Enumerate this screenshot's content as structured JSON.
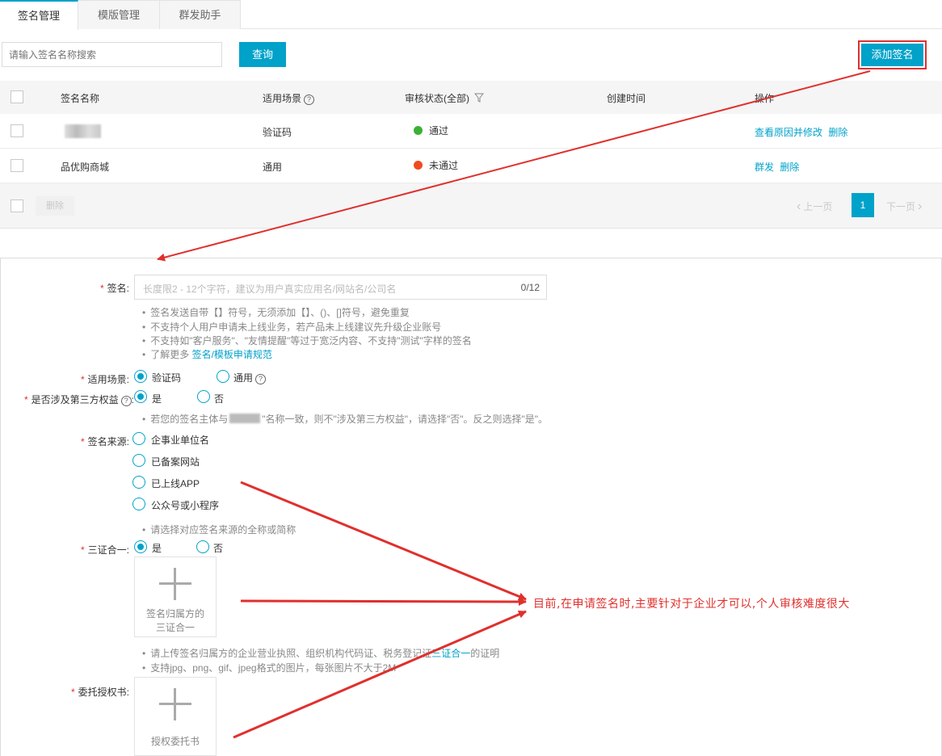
{
  "tabs": [
    "签名管理",
    "模版管理",
    "群发助手"
  ],
  "search": {
    "placeholder": "请输入签名名称搜索",
    "query_label": "查询"
  },
  "add_button": "添加签名",
  "table": {
    "columns": [
      "签名名称",
      "适用场景",
      "审核状态(全部)",
      "创建时间",
      "操作"
    ],
    "rows": [
      {
        "name": "",
        "scene": "验证码",
        "status": "通过",
        "status_color": "#3cb034",
        "actions": [
          "查看原因并修改",
          "删除"
        ]
      },
      {
        "name": "品优购商城",
        "scene": "通用",
        "status": "未通过",
        "status_color": "#f04a22",
        "actions": [
          "群发",
          "删除"
        ]
      }
    ],
    "footer": {
      "delete_label": "删除",
      "prev": "上一页",
      "page": "1",
      "next": "下一页"
    }
  },
  "form": {
    "sign_label": "签名:",
    "sign_placeholder": "长度限2 - 12个字符，建议为用户真实应用名/网站名/公司名",
    "sign_count": "0/12",
    "sign_hints": [
      "签名发送自带【】符号，无须添加【】、()、[]符号，避免重复",
      "不支持个人用户申请未上线业务，若产品未上线建议先升级企业账号",
      "不支持如\"客户服务\"、\"友情提醒\"等过于宽泛内容、不支持\"测试\"字样的签名"
    ],
    "sign_hint_more_prefix": "了解更多",
    "sign_hint_more_link": "签名/模板申请规范",
    "scene_label": "适用场景:",
    "scene_options": [
      "验证码",
      "通用"
    ],
    "third_party_label": "是否涉及第三方权益",
    "third_party_options": [
      "是",
      "否"
    ],
    "third_party_hint_prefix": "若您的签名主体与",
    "third_party_hint_suffix": "\"名称一致，则不\"涉及第三方权益\"，请选择\"否\"。反之则选择\"是\"。",
    "source_label": "签名来源:",
    "source_options": [
      "企事业单位名",
      "已备案网站",
      "已上线APP",
      "公众号或小程序"
    ],
    "source_hint": "请选择对应签名来源的全称或简称",
    "license_label": "三证合一:",
    "license_options": [
      "是",
      "否"
    ],
    "license_upload": [
      "签名归属方的",
      "三证合一"
    ],
    "license_hint_prefix": "请上传签名归属方的企业营业执照、组织机构代码证、税务登记证",
    "license_hint_link": "三证合一",
    "license_hint_suffix": "的证明",
    "format_hint": "支持jpg、png、gif、jpeg格式的图片，每张图片不大于2M",
    "auth_label": "委托授权书:",
    "auth_upload": "授权委托书"
  },
  "annotation": "目前,在申请签名时,主要针对于企业才可以,个人审核难度很大",
  "colors": {
    "accent": "#00a2ca",
    "annotation": "#e0302d"
  }
}
